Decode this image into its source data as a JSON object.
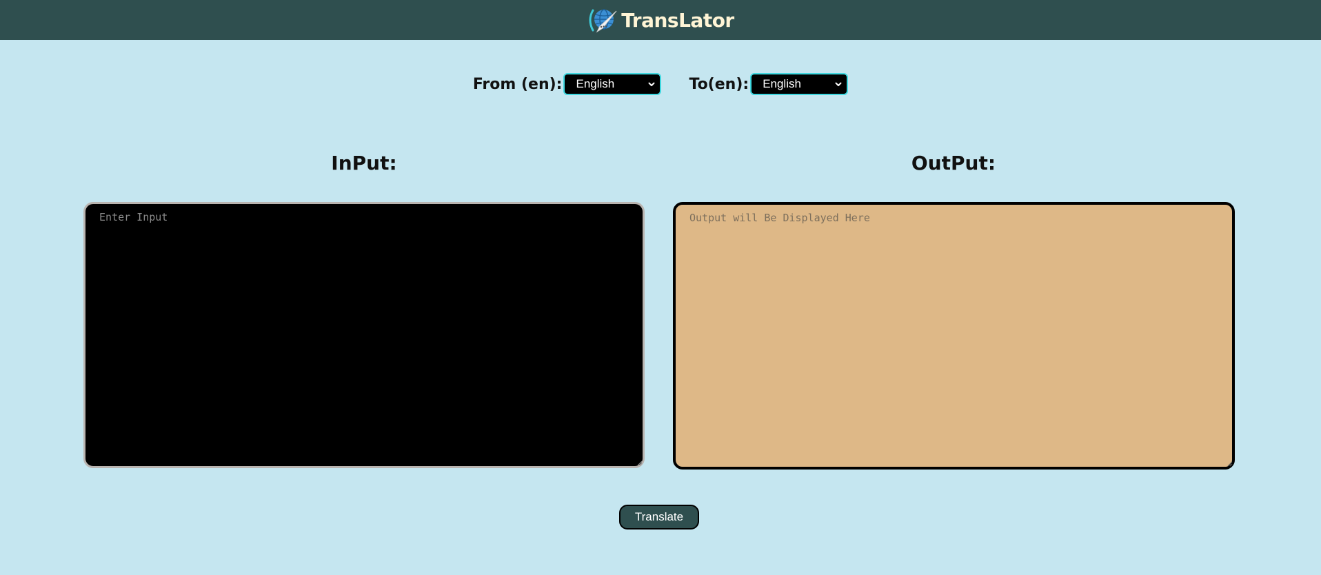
{
  "header": {
    "brand_name": "TransLator",
    "logo_icon": "globe-chat-icon",
    "background": "#2f4f4f"
  },
  "languages": {
    "from_label": "From (en):",
    "from_selected": "English",
    "to_label": "To(en):",
    "to_selected": "English"
  },
  "input_panel": {
    "heading": "InPut:",
    "placeholder": "Enter Input",
    "value": ""
  },
  "output_panel": {
    "heading": "OutPut:",
    "placeholder": "Output will Be Displayed Here",
    "value": ""
  },
  "actions": {
    "translate_label": "Translate"
  },
  "colors": {
    "page_background": "#c5e6f0",
    "accent": "#3fd8e0",
    "output_background": "#deb887",
    "button_background": "#2f4f4f"
  }
}
